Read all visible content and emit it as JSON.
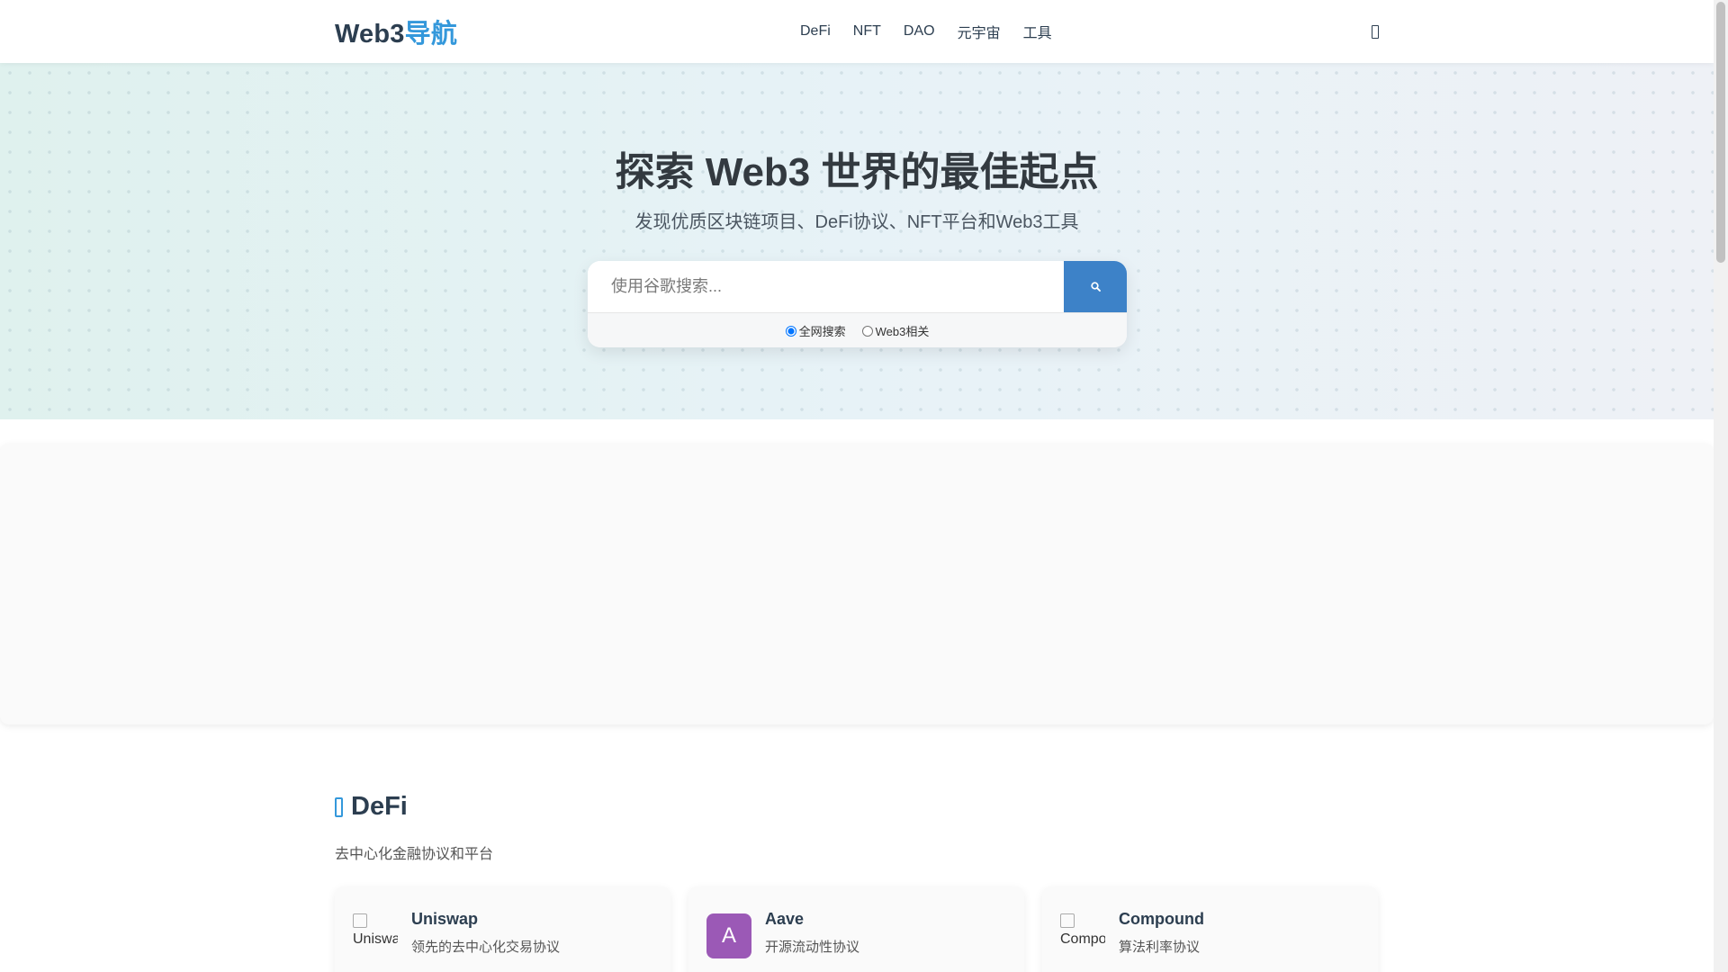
{
  "nav": {
    "logo_main": "Web3",
    "logo_accent": "导航",
    "links": [
      "DeFi",
      "NFT",
      "DAO",
      "元宇宙",
      "工具"
    ],
    "theme_icon": "moon-icon"
  },
  "hero": {
    "title": "探索 Web3 世界的最佳起点",
    "subtitle": "发现优质区块链项目、DeFi协议、NFT平台和Web3工具",
    "search": {
      "placeholder": "使用谷歌搜索...",
      "button_icon": "search-icon",
      "options": [
        {
          "label": "全网搜索",
          "checked": true
        },
        {
          "label": "Web3相关",
          "checked": false
        }
      ]
    }
  },
  "section": {
    "icon": "coins-icon",
    "title": "DeFi",
    "description": "去中心化金融协议和平台",
    "cards": [
      {
        "logo_alt": "Uniswap",
        "name": "Uniswap",
        "description": "领先的去中心化交易协议"
      },
      {
        "logo_letter": "A",
        "name": "Aave",
        "description": "开源流动性协议",
        "logo_color": "#9b59b6"
      },
      {
        "logo_alt": "Compound",
        "name": "Compound",
        "description": "算法利率协议"
      }
    ]
  },
  "colors": {
    "brand": "#3498db",
    "search_button": "#3d82c8",
    "text": "#2c3e50"
  }
}
